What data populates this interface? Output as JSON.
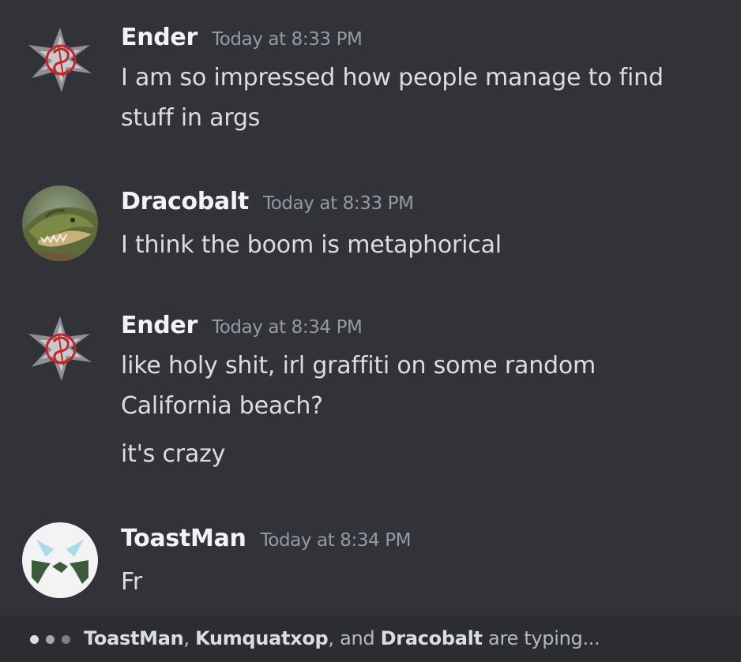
{
  "messages": [
    {
      "username": "Ender",
      "timestamp": "Today at 8:33 PM",
      "avatar_icon": "ender-sigil-icon",
      "lines": [
        "I am so impressed how people manage to find",
        "stuff in args"
      ]
    },
    {
      "username": "Dracobalt",
      "timestamp": "Today at 8:33 PM",
      "avatar_icon": "dragon-photo-avatar",
      "lines": [
        "I think the boom is metaphorical"
      ]
    },
    {
      "username": "Ender",
      "timestamp": "Today at 8:34 PM",
      "avatar_icon": "ender-sigil-icon",
      "lines": [
        "like holy shit, irl graffiti on some random",
        "California beach?",
        "it's crazy"
      ]
    },
    {
      "username": "ToastMan",
      "timestamp": "Today at 8:34 PM",
      "avatar_icon": "toastman-logo-avatar",
      "lines": [
        "Fr"
      ]
    }
  ],
  "typing": {
    "user1": "ToastMan",
    "sep1": ", ",
    "user2": "Kumquatxop",
    "sep2": ", and ",
    "user3": "Dracobalt",
    "suffix": " are typing..."
  },
  "colors": {
    "background": "#313338",
    "typing_bar": "#2b2d31",
    "username": "#f2f3f5",
    "timestamp": "#949ba4",
    "message_text": "#dbdee1",
    "ender_red": "#c0262d"
  }
}
